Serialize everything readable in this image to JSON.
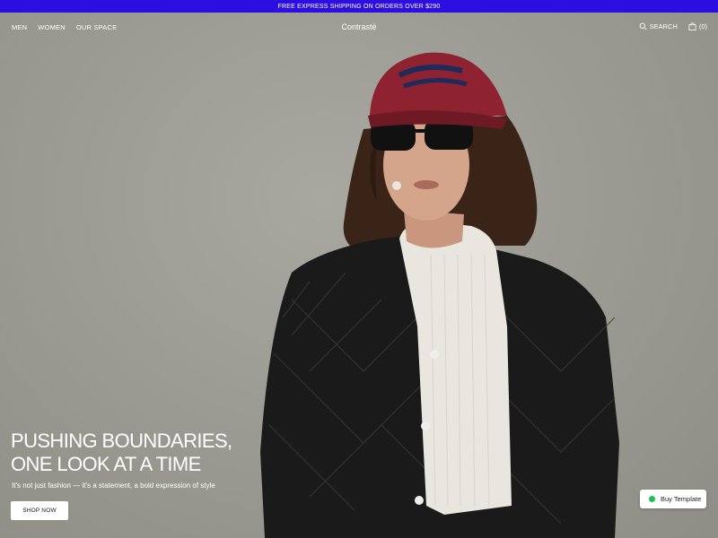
{
  "announcement": "FREE EXPRESS SHIPPING ON ORDERS OVER $290",
  "nav": {
    "links": [
      "MEN",
      "WOMEN",
      "OUR SPACE"
    ],
    "brand": "Contrasté",
    "search_label": "SEARCH",
    "cart_label": "(0)"
  },
  "hero": {
    "headline_line1": "PUSHING BOUNDARIES,",
    "headline_line2": "ONE LOOK AT A TIME",
    "tagline": "It's not just fashion — it's a statement, a bold expression of style",
    "cta_label": "SHOP NOW"
  },
  "buy_template": {
    "label": "Buy Template",
    "status_color": "#1fbf55"
  },
  "colors": {
    "announce_bg": "#2c0fe0",
    "hero_bg": "#9a9a92"
  }
}
